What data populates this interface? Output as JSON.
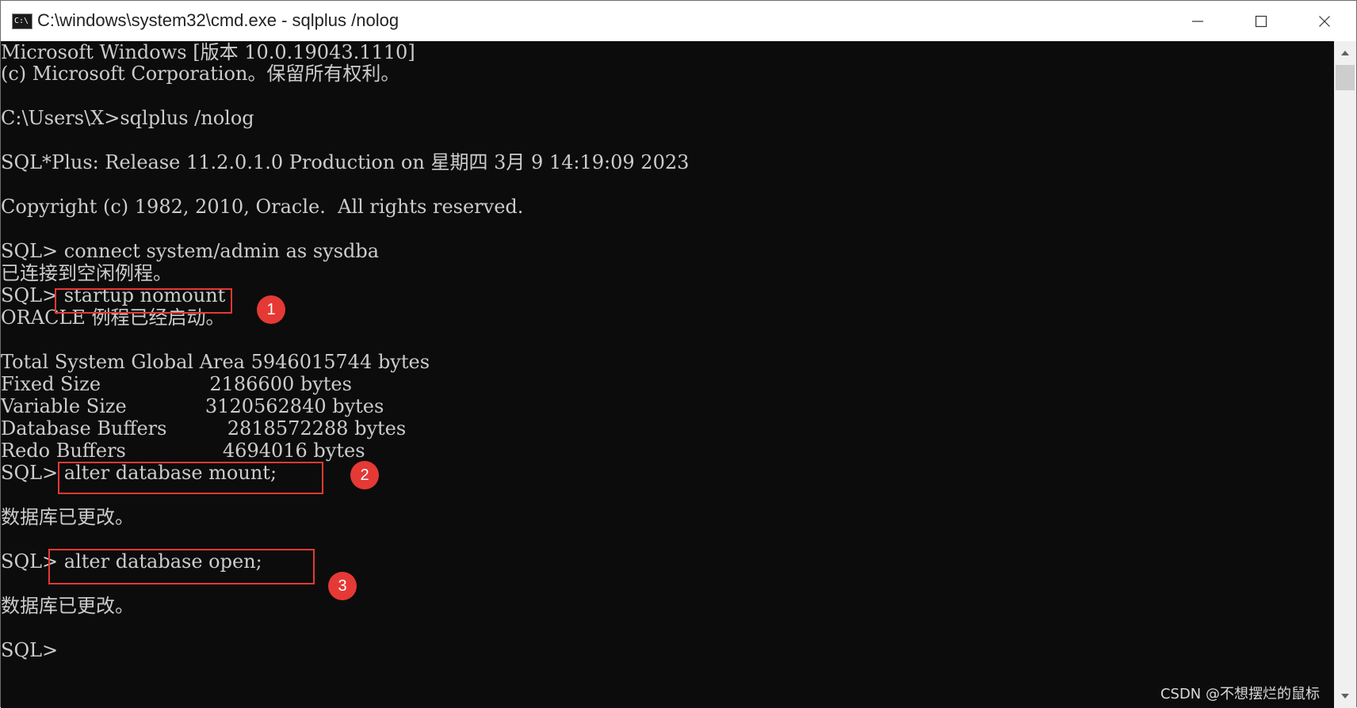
{
  "window": {
    "title": "C:\\windows\\system32\\cmd.exe - sqlplus  /nolog",
    "icon": "cmd-icon",
    "icon_text": "C:\\"
  },
  "controls": {
    "minimize_icon": "minimize-icon",
    "maximize_icon": "maximize-icon",
    "close_icon": "close-icon"
  },
  "terminal": {
    "lines": [
      "Microsoft Windows [版本 10.0.19043.1110]",
      "(c) Microsoft Corporation。保留所有权利。",
      "",
      "C:\\Users\\X>sqlplus /nolog",
      "",
      "SQL*Plus: Release 11.2.0.1.0 Production on 星期四 3月 9 14:19:09 2023",
      "",
      "Copyright (c) 1982, 2010, Oracle.  All rights reserved.",
      "",
      "SQL> connect system/admin as sysdba",
      "已连接到空闲例程。",
      "SQL> startup nomount",
      "ORACLE 例程已经启动。",
      "",
      "Total System Global Area 5946015744 bytes",
      "Fixed Size                  2186600 bytes",
      "Variable Size             3120562840 bytes",
      "Database Buffers          2818572288 bytes",
      "Redo Buffers                4694016 bytes",
      "SQL> alter database mount;",
      "",
      "数据库已更改。",
      "",
      "SQL> alter database open;",
      "",
      "数据库已更改。",
      "",
      "SQL>"
    ]
  },
  "annotations": {
    "markers": [
      "1",
      "2",
      "3"
    ]
  },
  "watermark": "CSDN @不想摆烂的鼠标",
  "colors": {
    "terminal_bg": "#0c0c0c",
    "terminal_text": "#cccccc",
    "highlight": "#e53935"
  }
}
